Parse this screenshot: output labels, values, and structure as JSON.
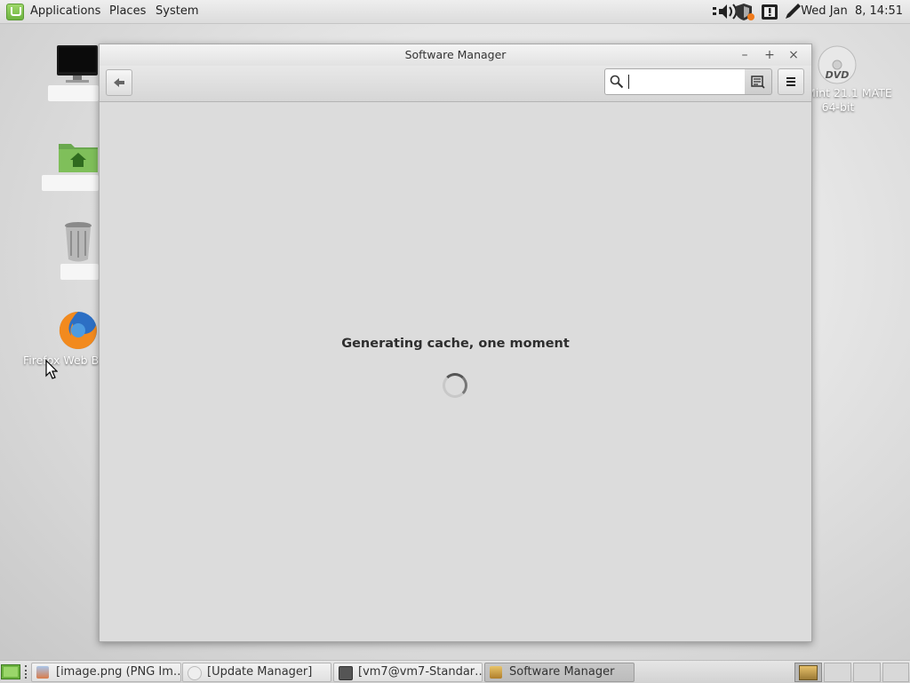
{
  "top_panel": {
    "menus": [
      "Applications",
      "Places",
      "System"
    ],
    "clock": "Wed Jan  8, 14:51",
    "tray_icons": [
      "network-icon",
      "volume-icon",
      "shield-update-icon",
      "alert-icon",
      "pen-icon"
    ]
  },
  "desktop": {
    "icons": [
      {
        "name": "computer-icon",
        "label": ""
      },
      {
        "name": "home-folder-icon",
        "label": ""
      },
      {
        "name": "trash-icon",
        "label": ""
      },
      {
        "name": "firefox-icon",
        "label": "Firefox Web B"
      },
      {
        "name": "dvd-icon",
        "label_line1": "Mint 21.1 MATE",
        "label_line2": "64-bit"
      }
    ]
  },
  "window": {
    "title": "Software Manager",
    "controls": {
      "minimize": "–",
      "maximize": "+",
      "close": "×"
    },
    "search": {
      "value": "",
      "placeholder": ""
    },
    "status_text": "Generating cache, one moment"
  },
  "taskbar": {
    "tasks": [
      {
        "label": "[image.png (PNG Im…",
        "icon": "image-viewer-icon",
        "active": false
      },
      {
        "label": "[Update Manager]",
        "icon": "update-manager-icon",
        "active": false
      },
      {
        "label": "[vm7@vm7-Standar…",
        "icon": "terminal-icon",
        "active": false
      },
      {
        "label": "Software Manager",
        "icon": "software-manager-icon",
        "active": true
      }
    ]
  },
  "colors": {
    "mint_green": "#6cb33f",
    "window_bg": "#dcdcdc",
    "panel_bg": "#dcdcdc"
  }
}
